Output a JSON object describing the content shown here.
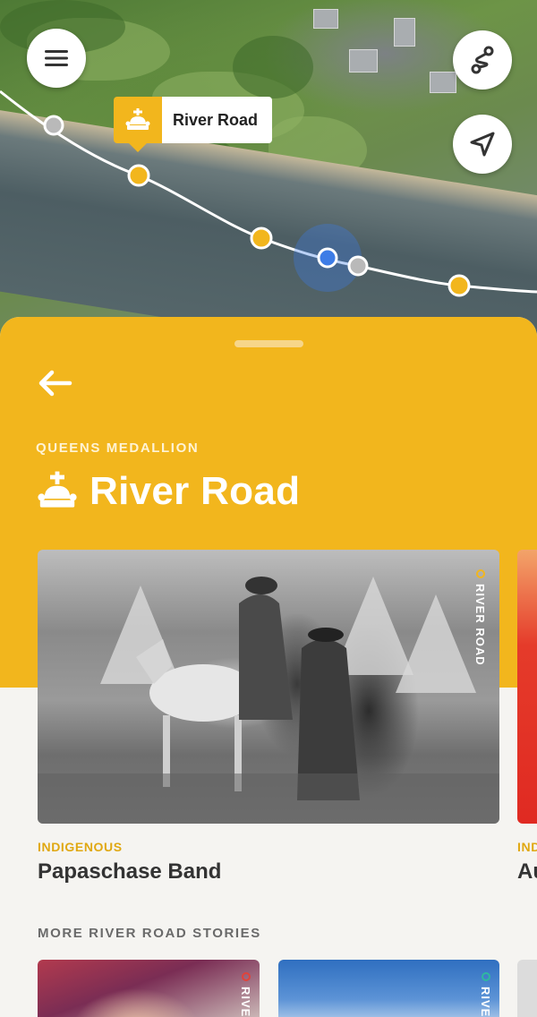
{
  "map": {
    "marker_label": "River Road",
    "buttons": {
      "menu": "menu-icon",
      "route": "route-icon",
      "locate": "navigation-arrow-icon"
    }
  },
  "panel": {
    "eyebrow": "QUEENS MEDALLION",
    "title": "River Road",
    "featured": [
      {
        "category": "INDIGENOUS",
        "title": "Papaschase Band",
        "tag": "RIVER ROAD"
      },
      {
        "category": "IND",
        "title": "Au",
        "tag": ""
      }
    ],
    "more_label": "MORE RIVER ROAD STORIES",
    "more": [
      {
        "tag": "RIVER"
      },
      {
        "tag": "RIVER"
      }
    ]
  },
  "colors": {
    "accent": "#f2b61d",
    "text_dark": "#333333",
    "section_gray": "#6a6a6a",
    "location_blue": "#3d7ce6"
  }
}
